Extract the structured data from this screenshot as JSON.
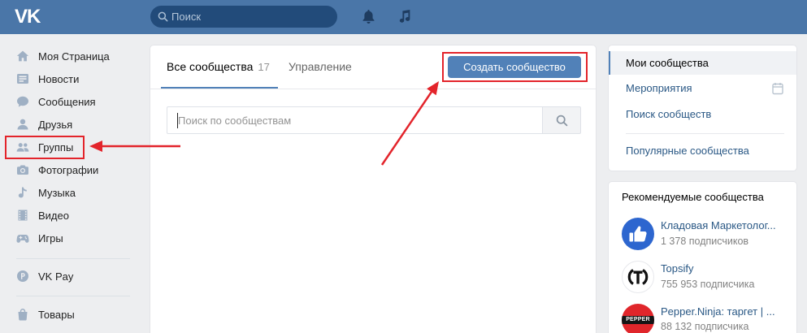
{
  "colors": {
    "header_bg": "#4a76a8",
    "search_bg": "#224b7a",
    "accent": "#5181b8",
    "link": "#2a5885",
    "page_bg": "#edeef0",
    "annotation": "#e3242b"
  },
  "header": {
    "logo": "VK",
    "search": {
      "value": "",
      "placeholder": "Поиск",
      "icon": "search-icon"
    },
    "notifications_icon": "bell-icon",
    "music_icon": "music-icon"
  },
  "sidebar": {
    "items": [
      {
        "label": "Моя Страница",
        "icon": "home-icon"
      },
      {
        "label": "Новости",
        "icon": "news-icon"
      },
      {
        "label": "Сообщения",
        "icon": "messages-icon"
      },
      {
        "label": "Друзья",
        "icon": "friends-icon"
      },
      {
        "label": "Группы",
        "icon": "groups-icon",
        "highlighted": true
      },
      {
        "label": "Фотографии",
        "icon": "photos-icon"
      },
      {
        "label": "Музыка",
        "icon": "music-icon"
      },
      {
        "label": "Видео",
        "icon": "video-icon"
      },
      {
        "label": "Игры",
        "icon": "games-icon"
      }
    ],
    "pay": {
      "label": "VK Pay",
      "icon": "vkpay-icon"
    },
    "market": {
      "label": "Товары",
      "icon": "market-icon"
    }
  },
  "main": {
    "tabs": [
      {
        "label": "Все сообщества",
        "count": "17",
        "active": true
      },
      {
        "label": "Управление",
        "active": false
      }
    ],
    "create_button": "Создать сообщество",
    "search": {
      "value": "",
      "placeholder": "Поиск по сообществам",
      "button_icon": "search-icon"
    }
  },
  "right_menu": {
    "items": [
      {
        "label": "Мои сообщества",
        "active": true
      },
      {
        "label": "Мероприятия",
        "icon": "calendar-icon"
      },
      {
        "label": "Поиск сообществ"
      }
    ],
    "popular": "Популярные сообщества"
  },
  "recommended": {
    "title": "Рекомендуемые сообщества",
    "items": [
      {
        "name": "Кладовая Маркетолог...",
        "subscribers": "1 378 подписчиков",
        "avatar": "thumbs-up-logo"
      },
      {
        "name": "Topsify",
        "subscribers": "755 953 подписчика",
        "avatar": "topsify-logo"
      },
      {
        "name": "Pepper.Ninja: таргет | ...",
        "subscribers": "88 132 подписчика",
        "avatar": "pepper-logo",
        "avatar_text": "PEPPER"
      }
    ]
  }
}
